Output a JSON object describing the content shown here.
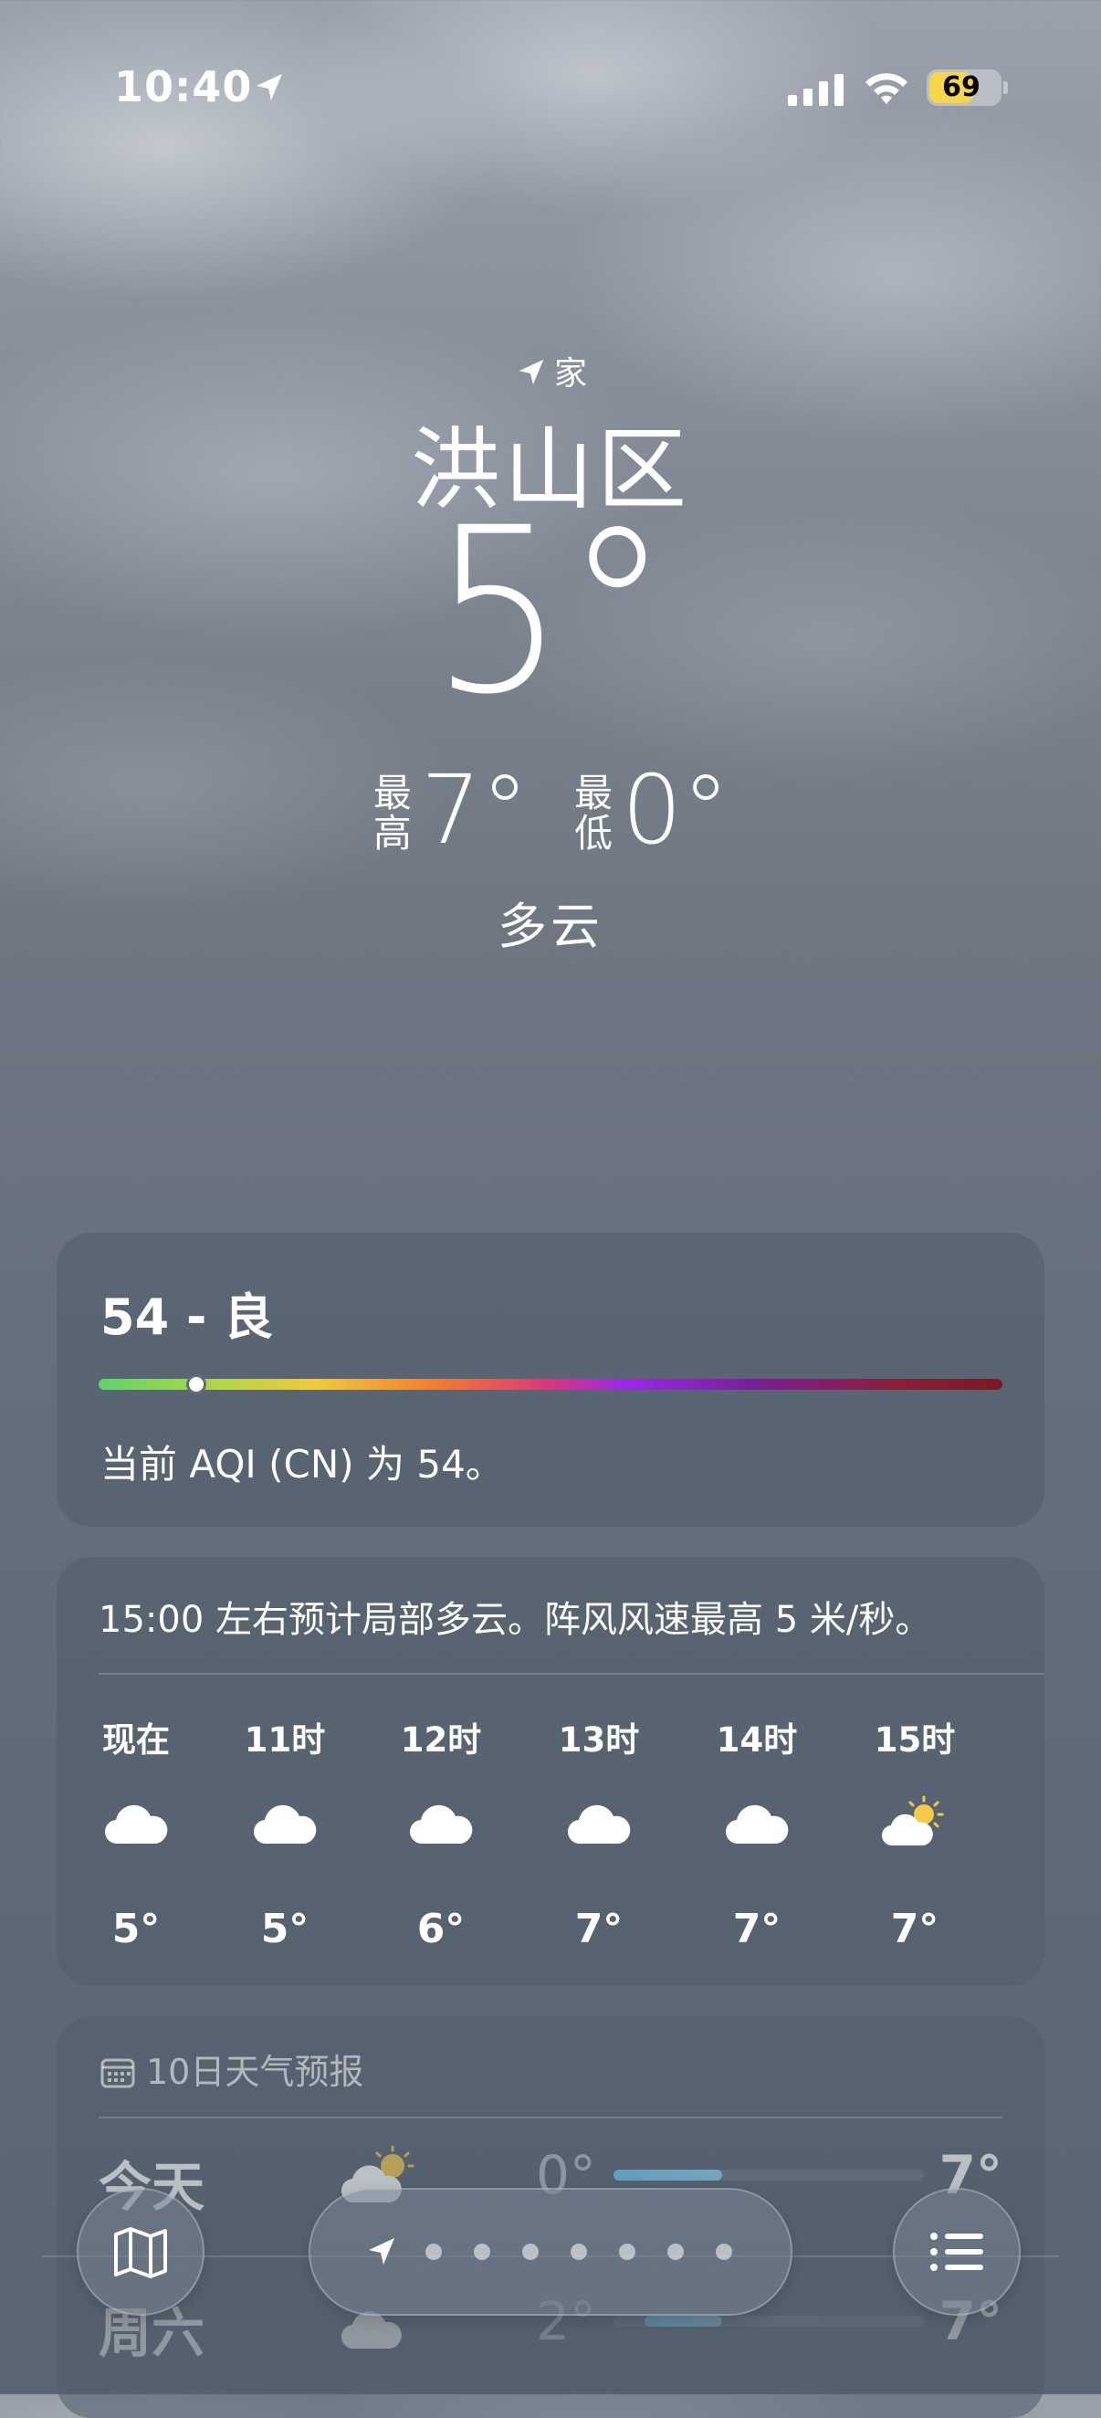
{
  "status_bar": {
    "time": "10:40",
    "battery": "69",
    "battery_level": 0.69
  },
  "hero": {
    "location_label": "家",
    "city": "洪山区",
    "temperature": "5°",
    "high_label_1": "最",
    "high_label_2": "高",
    "high": "7°",
    "low_label_1": "最",
    "low_label_2": "低",
    "low": "0°",
    "condition": "多云"
  },
  "aqi": {
    "title": "54 - 良",
    "description": "当前 AQI (CN) 为 54。",
    "value": 54,
    "scale_max": 500,
    "bar_colors": [
      "#5fd36a",
      "#f2c83c",
      "#ef7a32",
      "#d9367c",
      "#9a2ae6",
      "#7a1a22"
    ]
  },
  "hourly": {
    "summary": "15:00 左右预计局部多云。阵风风速最高 5 米/秒。",
    "items": [
      {
        "time": "现在",
        "icon": "cloud-icon",
        "temp": "5°"
      },
      {
        "time": "11时",
        "icon": "cloud-icon",
        "temp": "5°"
      },
      {
        "time": "12时",
        "icon": "cloud-icon",
        "temp": "6°"
      },
      {
        "time": "13时",
        "icon": "cloud-icon",
        "temp": "7°"
      },
      {
        "time": "14时",
        "icon": "cloud-icon",
        "temp": "7°"
      },
      {
        "time": "15时",
        "icon": "partly-sunny-icon",
        "temp": "7°"
      }
    ]
  },
  "forecast": {
    "header": "10日天气预报",
    "rows": [
      {
        "day": "今天",
        "icon": "partly-sunny-icon",
        "low": "0°",
        "high": "7°",
        "range_start": 0.0,
        "range_end": 0.35
      },
      {
        "day": "周六",
        "icon": "cloud-icon",
        "low": "2°",
        "high": "7°",
        "range_start": 0.1,
        "range_end": 0.35
      }
    ]
  },
  "toolbar": {
    "page_count": 7,
    "current_page": 0
  }
}
